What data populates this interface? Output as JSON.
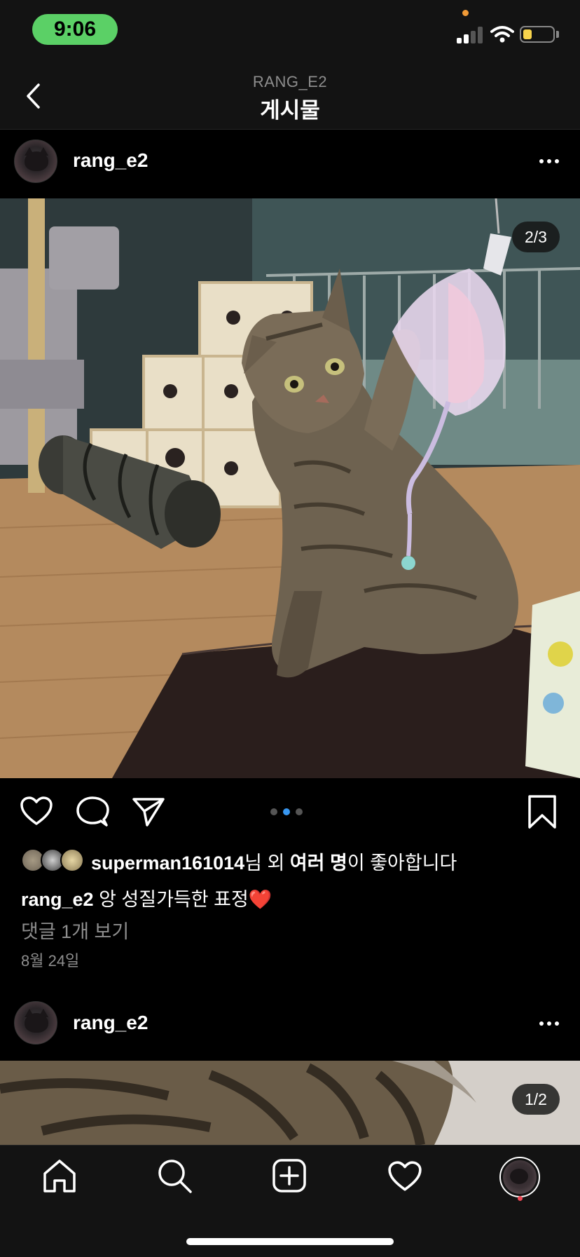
{
  "status_bar": {
    "time": "9:06",
    "time_pill_color": "#5bd066",
    "battery_color": "#f7d44c",
    "icons": [
      "signal-icon",
      "wifi-icon",
      "battery-icon"
    ]
  },
  "header": {
    "subtitle": "RANG_E2",
    "title": "게시물"
  },
  "posts": [
    {
      "username": "rang_e2",
      "image_counter": "2/3",
      "carousel": {
        "count": 3,
        "active": 2
      },
      "likes": {
        "user": "superman161014",
        "suffix1": "님 외 ",
        "others": "여러 명",
        "suffix2": "이 좋아합니다"
      },
      "caption": {
        "username": "rang_e2",
        "text": " 앙 성질가득한 표정",
        "emoji": "❤️"
      },
      "comments_link": "댓글 1개 보기",
      "date": "8월 24일"
    },
    {
      "username": "rang_e2",
      "image_counter": "1/2"
    }
  ],
  "tab_bar": {
    "tabs": [
      "home-icon",
      "search-icon",
      "add-post-icon",
      "activity-heart-icon",
      "profile-avatar"
    ],
    "notification_dot_color": "#ed4956"
  }
}
